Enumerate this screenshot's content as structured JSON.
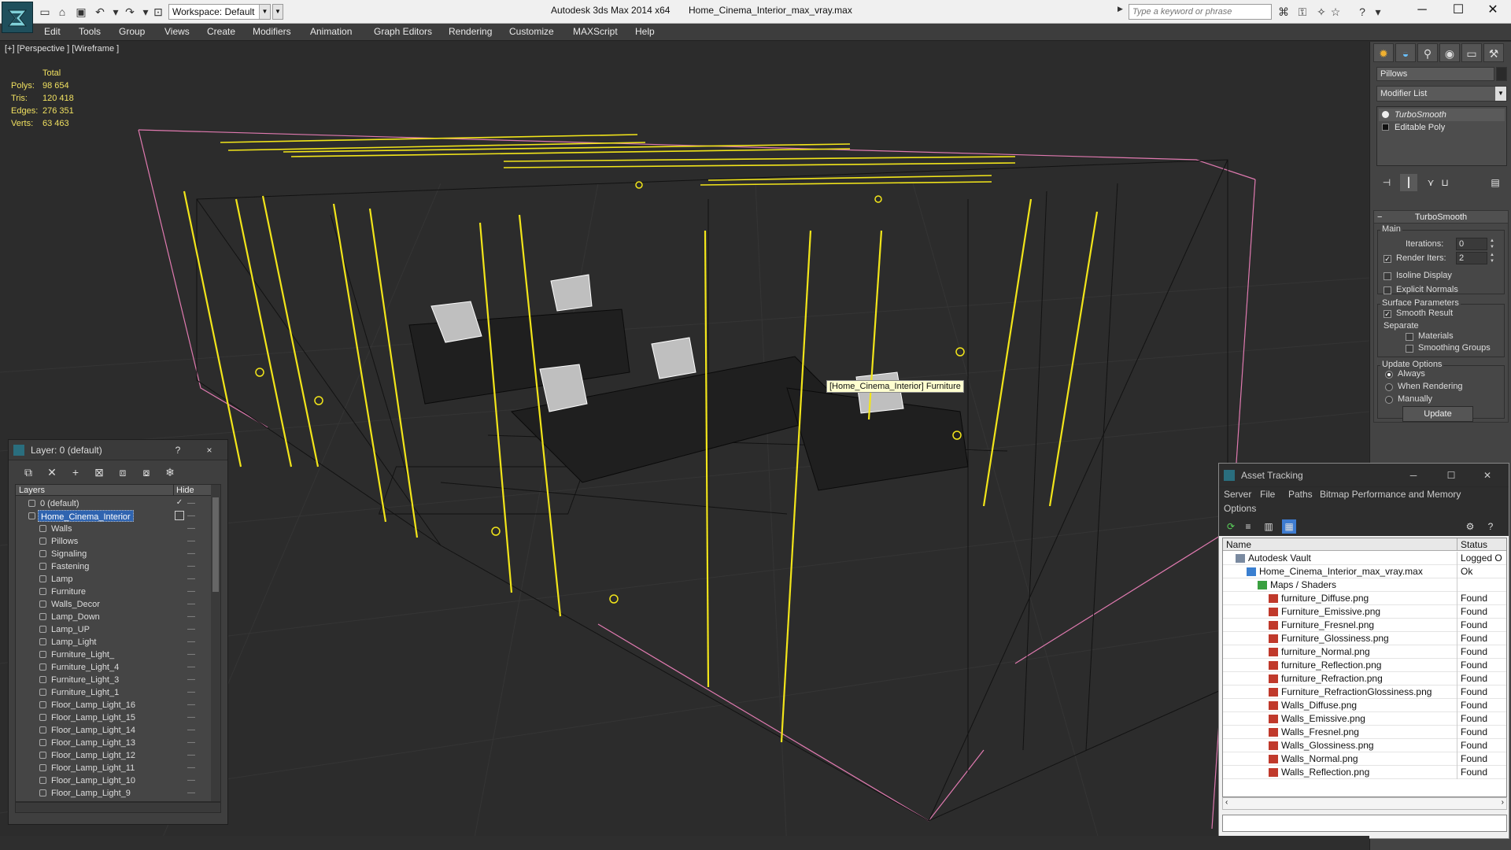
{
  "titlebar": {
    "app_title": "Autodesk 3ds Max  2014 x64",
    "file_title": "Home_Cinema_Interior_max_vray.max",
    "workspace": "Workspace: Default",
    "search_placeholder": "Type a keyword or phrase",
    "quick_access_icons": [
      "new-file-icon",
      "open-file-icon",
      "save-icon",
      "undo-icon",
      "redo-icon",
      "project-folder-icon"
    ],
    "help_icons": [
      "binoculars-icon",
      "key-icon",
      "star-icon",
      "help-icon"
    ],
    "window_buttons": [
      "minimize",
      "maximize",
      "close"
    ]
  },
  "menubar": {
    "items": [
      "Edit",
      "Tools",
      "Group",
      "Views",
      "Create",
      "Modifiers",
      "Animation",
      "Graph Editors",
      "Rendering",
      "Customize",
      "MAXScript",
      "Help"
    ]
  },
  "viewport": {
    "label": "[+] [Perspective ] [Wireframe ]",
    "stats": {
      "header": "Total",
      "rows": [
        {
          "key": "Polys:",
          "value": "98 654"
        },
        {
          "key": "Tris:",
          "value": "120 418"
        },
        {
          "key": "Edges:",
          "value": "276 351"
        },
        {
          "key": "Verts:",
          "value": "63 463"
        }
      ]
    },
    "tooltip": "[Home_Cinema_Interior] Furniture",
    "colors": {
      "selected_wire": "#f2e51a",
      "scene_wire": "#0f0f0f",
      "bbox": "#e07ab0",
      "grid": "#3a3a3a"
    }
  },
  "command_panel": {
    "object_name": "Pillows",
    "modifier_list": "Modifier List",
    "stack": [
      "TurboSmooth",
      "Editable Poly"
    ],
    "rollout_title": "TurboSmooth",
    "main_group": "Main",
    "iterations_label": "Iterations:",
    "iterations_value": "0",
    "render_iters_label": "Render Iters:",
    "render_iters_value": "2",
    "render_iters_checked": true,
    "isoline_label": "Isoline Display",
    "explicit_normals_label": "Explicit Normals",
    "surface_group": "Surface Parameters",
    "smooth_result_label": "Smooth Result",
    "separate_label": "Separate",
    "materials_label": "Materials",
    "smoothing_groups_label": "Smoothing Groups",
    "update_group": "Update Options",
    "update_options": [
      "Always",
      "When Rendering",
      "Manually"
    ],
    "update_selected": "Always",
    "update_button": "Update",
    "tab_icons": [
      "create-icon",
      "modify-icon",
      "hierarchy-icon",
      "motion-icon",
      "display-icon",
      "utilities-icon"
    ]
  },
  "layer_panel": {
    "title": "Layer: 0 (default)",
    "help": "?",
    "close": "×",
    "col_layers": "Layers",
    "col_hide": "Hide",
    "rows": [
      {
        "name": "0 (default)",
        "indent": 1,
        "check": true,
        "selected": false
      },
      {
        "name": "Home_Cinema_Interior",
        "indent": 1,
        "check": false,
        "selected": true
      },
      {
        "name": "Walls",
        "indent": 2
      },
      {
        "name": "Pillows",
        "indent": 2
      },
      {
        "name": "Signaling",
        "indent": 2
      },
      {
        "name": "Fastening",
        "indent": 2
      },
      {
        "name": "Lamp",
        "indent": 2
      },
      {
        "name": "Furniture",
        "indent": 2
      },
      {
        "name": "Walls_Decor",
        "indent": 2
      },
      {
        "name": "Lamp_Down",
        "indent": 2
      },
      {
        "name": "Lamp_UP",
        "indent": 2
      },
      {
        "name": "Lamp_Light",
        "indent": 2
      },
      {
        "name": "Furniture_Light_",
        "indent": 2
      },
      {
        "name": "Furniture_Light_4",
        "indent": 2
      },
      {
        "name": "Furniture_Light_3",
        "indent": 2
      },
      {
        "name": "Furniture_Light_1",
        "indent": 2
      },
      {
        "name": "Floor_Lamp_Light_16",
        "indent": 2
      },
      {
        "name": "Floor_Lamp_Light_15",
        "indent": 2
      },
      {
        "name": "Floor_Lamp_Light_14",
        "indent": 2
      },
      {
        "name": "Floor_Lamp_Light_13",
        "indent": 2
      },
      {
        "name": "Floor_Lamp_Light_12",
        "indent": 2
      },
      {
        "name": "Floor_Lamp_Light_11",
        "indent": 2
      },
      {
        "name": "Floor_Lamp_Light_10",
        "indent": 2
      },
      {
        "name": "Floor_Lamp_Light_9",
        "indent": 2
      }
    ]
  },
  "asset_panel": {
    "title": "Asset Tracking",
    "menu": [
      "Server",
      "File",
      "Paths",
      "Bitmap Performance and Memory",
      "Options"
    ],
    "col_name": "Name",
    "col_status": "Status",
    "rows": [
      {
        "name": "Autodesk Vault",
        "status": "Logged O",
        "indent": 1,
        "icon": "vault"
      },
      {
        "name": "Home_Cinema_Interior_max_vray.max",
        "status": "Ok",
        "indent": 2,
        "icon": "max"
      },
      {
        "name": "Maps / Shaders",
        "status": "",
        "indent": 3,
        "icon": "maps"
      },
      {
        "name": "furniture_Diffuse.png",
        "status": "Found",
        "indent": 4,
        "icon": "png"
      },
      {
        "name": "Furniture_Emissive.png",
        "status": "Found",
        "indent": 4,
        "icon": "png"
      },
      {
        "name": "Furniture_Fresnel.png",
        "status": "Found",
        "indent": 4,
        "icon": "png"
      },
      {
        "name": "Furniture_Glossiness.png",
        "status": "Found",
        "indent": 4,
        "icon": "png"
      },
      {
        "name": "furniture_Normal.png",
        "status": "Found",
        "indent": 4,
        "icon": "png"
      },
      {
        "name": "furniture_Reflection.png",
        "status": "Found",
        "indent": 4,
        "icon": "png"
      },
      {
        "name": "furniture_Refraction.png",
        "status": "Found",
        "indent": 4,
        "icon": "png"
      },
      {
        "name": "Furniture_RefractionGlossiness.png",
        "status": "Found",
        "indent": 4,
        "icon": "png"
      },
      {
        "name": "Walls_Diffuse.png",
        "status": "Found",
        "indent": 4,
        "icon": "png"
      },
      {
        "name": "Walls_Emissive.png",
        "status": "Found",
        "indent": 4,
        "icon": "png"
      },
      {
        "name": "Walls_Fresnel.png",
        "status": "Found",
        "indent": 4,
        "icon": "png"
      },
      {
        "name": "Walls_Glossiness.png",
        "status": "Found",
        "indent": 4,
        "icon": "png"
      },
      {
        "name": "Walls_Normal.png",
        "status": "Found",
        "indent": 4,
        "icon": "png"
      },
      {
        "name": "Walls_Reflection.png",
        "status": "Found",
        "indent": 4,
        "icon": "png"
      }
    ]
  }
}
